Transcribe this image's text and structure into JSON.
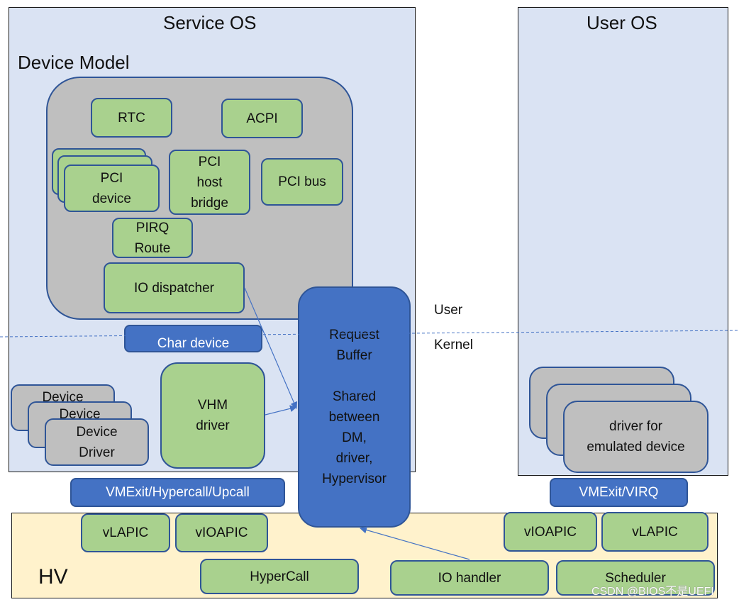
{
  "service_os": {
    "title": "Service OS",
    "device_model": {
      "title": "Device Model",
      "components": {
        "rtc": "RTC",
        "acpi": "ACPI",
        "pci_device": "PCI\ndevice",
        "pci_host_bridge": "PCI\nhost\nbridge",
        "pci_bus": "PCI bus",
        "pirq_route": "PIRQ\nRoute",
        "io_dispatcher": "IO dispatcher"
      }
    },
    "char_device": "Char device",
    "device_driver_stack": [
      "Device",
      "Device",
      "Device\nDriver"
    ],
    "vhm_driver": "VHM\ndriver"
  },
  "request_buffer": {
    "line1": "Request\nBuffer",
    "line2": "Shared\nbetween\nDM,\ndriver,\nHypervisor"
  },
  "privilege_levels": {
    "user": "User",
    "kernel": "Kernel"
  },
  "user_os": {
    "title": "User OS",
    "driver_stack_label": "driver for\nemulated device"
  },
  "interfaces": {
    "sos_to_hv": "VMExit/Hypercall/Upcall",
    "uos_to_hv": "VMExit/VIRQ"
  },
  "hv": {
    "title": "HV",
    "components": {
      "vlapic_left": "vLAPIC",
      "vioapic_left": "vIOAPIC",
      "hypercall": "HyperCall",
      "io_handler": "IO handler",
      "vioapic_right": "vIOAPIC",
      "vlapic_right": "vLAPIC",
      "scheduler": "Scheduler"
    }
  },
  "colors": {
    "os_panel": "#dae3f3",
    "hv_panel": "#fff2cc",
    "component_green": "#a9d18e",
    "component_gray": "#bfbfbf",
    "interface_blue": "#4472c4",
    "border_blue": "#2f5597"
  },
  "watermark": "CSDN @BIOS不是UEFI"
}
